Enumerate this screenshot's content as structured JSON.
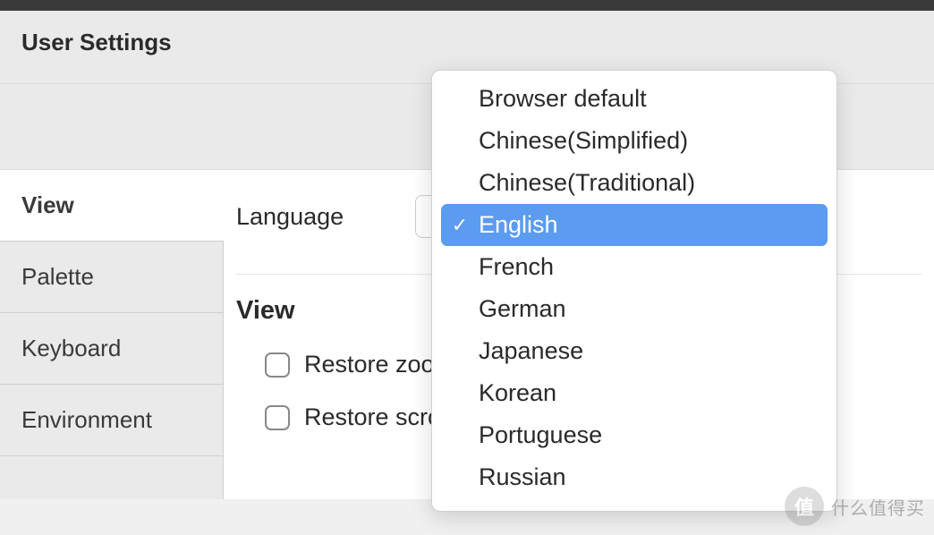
{
  "header": {
    "title": "User Settings"
  },
  "sidebar": {
    "tabs": [
      {
        "label": "View",
        "active": true
      },
      {
        "label": "Palette",
        "active": false
      },
      {
        "label": "Keyboard",
        "active": false
      },
      {
        "label": "Environment",
        "active": false
      }
    ]
  },
  "content": {
    "language_label": "Language",
    "section_title": "View",
    "checkboxes": [
      {
        "label": "Restore zoom level on load",
        "visible_label": "Restore zoo"
      },
      {
        "label": "Restore scroll position on load",
        "visible_label": "Restore scroll position on load"
      }
    ]
  },
  "dropdown": {
    "options": [
      "Browser default",
      "Chinese(Simplified)",
      "Chinese(Traditional)",
      "English",
      "French",
      "German",
      "Japanese",
      "Korean",
      "Portuguese",
      "Russian"
    ],
    "selected": "English"
  },
  "watermark": {
    "badge": "值",
    "text": "什么值得买"
  }
}
